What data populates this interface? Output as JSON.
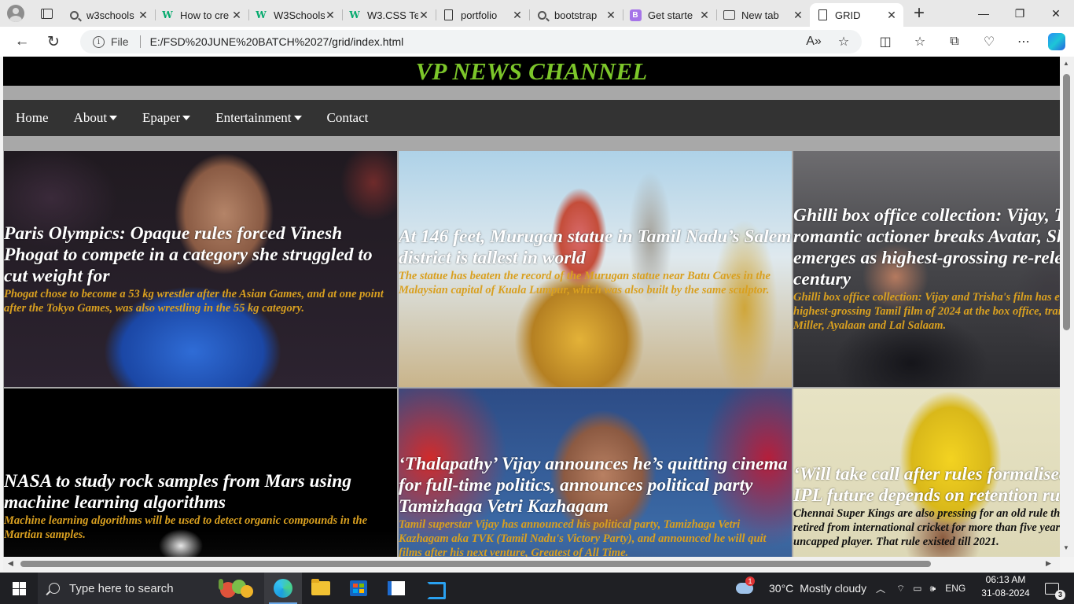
{
  "browser": {
    "tabs": [
      {
        "label": "w3schools",
        "icon": "search-icon",
        "active": false
      },
      {
        "label": "How to cre",
        "icon": "w3schools-icon",
        "active": false
      },
      {
        "label": "W3Schools",
        "icon": "w3schools-icon",
        "active": false
      },
      {
        "label": "W3.CSS Te",
        "icon": "w3schools-icon",
        "active": false
      },
      {
        "label": "portfolio",
        "icon": "file-icon",
        "active": false
      },
      {
        "label": "bootstrap",
        "icon": "search-icon",
        "active": false
      },
      {
        "label": "Get starte",
        "icon": "bootstrap-icon",
        "active": false
      },
      {
        "label": "New tab",
        "icon": "newtab-icon",
        "active": false
      },
      {
        "label": "GRID",
        "icon": "file-icon",
        "active": true
      }
    ],
    "bootstrap_letter": "B",
    "address": {
      "file_label": "File",
      "url": "E:/FSD%20JUNE%20BATCH%2027/grid/index.html"
    }
  },
  "page": {
    "title": "VP NEWS CHANNEL",
    "nav": [
      {
        "label": "Home",
        "dropdown": false
      },
      {
        "label": "About",
        "dropdown": true
      },
      {
        "label": "Epaper",
        "dropdown": true
      },
      {
        "label": "Entertainment",
        "dropdown": true
      },
      {
        "label": "Contact",
        "dropdown": false
      }
    ],
    "cards": [
      {
        "headline": "Paris Olympics: Opaque rules forced Vinesh Phogat to compete in a category she struggled to cut weight for",
        "summary": "Phogat chose to become a 53 kg wrestler after the Asian Games, and at one point after the Tokyo Games, was also wrestling in the 55 kg category."
      },
      {
        "headline": "At 146 feet, Murugan statue in Tamil Nadu’s Salem district is tallest in world",
        "summary": "The statue has beaten the record of the Murugan statue near Batu Caves in the Malaysian capital of Kuala Lumpur, which was also built by the same sculptor."
      },
      {
        "headline": "Ghilli box office collection: Vijay, Trisha's romantic actioner breaks Avatar, Sholay record; emerges as highest-grossing re-release of the century",
        "summary": "Ghilli box office collection: Vijay and Trisha's film has emerged as the fourth highest-grossing Tamil film of 2024 at the box office, trailing behind Captain Miller, Ayalaan and Lal Salaam."
      },
      {
        "headline": "NASA to study rock samples from Mars using machine learning algorithms",
        "summary": "Machine learning algorithms will be used to detect organic compounds in the Martian samples."
      },
      {
        "headline": "‘Thalapathy’ Vijay announces he’s quitting cinema for full-time politics, announces political party Tamizhaga Vetri Kazhagam",
        "summary": "Tamil superstar Vijay has announced his political party, Tamizhaga Vetri Kazhagam aka TVK (Tamil Nadu's Victory Party), and announced he will quit films after his next venture, Greatest of All Time."
      },
      {
        "headline": "‘Will take call after rules formalised’: Dhoni on IPL future depends on retention rules",
        "summary": "Chennai Super Kings are also pressing for an old rule that allowed a player who is retired from international cricket for more than five years to be treated as an uncapped player. That rule existed till 2021."
      }
    ]
  },
  "taskbar": {
    "search_placeholder": "Type here to search",
    "weather": {
      "temp": "30°C",
      "condition": "Mostly cloudy",
      "badge": "1"
    },
    "language": "ENG",
    "time": "06:13 AM",
    "date": "31-08-2024",
    "notifications": "3"
  },
  "colors": {
    "title_green": "#7cc62a",
    "summary_gold": "#d9a020",
    "nav_bg": "#333333",
    "header_bg": "#000000"
  }
}
